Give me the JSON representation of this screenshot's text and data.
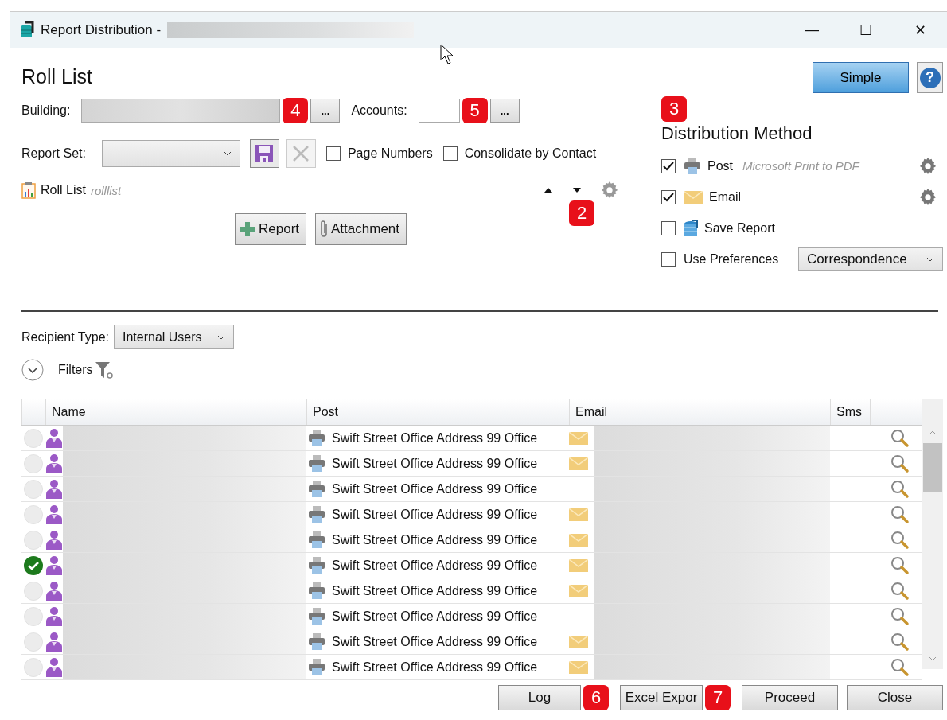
{
  "window": {
    "title": "Report Distribution -",
    "controls": [
      "—",
      "☐",
      "✕"
    ]
  },
  "heading": "Roll List",
  "simple_button": "Simple",
  "help_button": "?",
  "building": {
    "label": "Building:",
    "browse": "...",
    "callout": "4"
  },
  "accounts": {
    "label": "Accounts:",
    "browse": "...",
    "callout": "5"
  },
  "report_set": {
    "label": "Report Set:"
  },
  "options": [
    {
      "label": "Page Numbers",
      "checked": false
    },
    {
      "label": "Consolidate by Contact",
      "checked": false
    }
  ],
  "report_item": {
    "name": "Roll List",
    "code": "rolllist",
    "callout": "2"
  },
  "add_buttons": [
    {
      "kind": "report",
      "label": "Report"
    },
    {
      "kind": "attachment",
      "label": "Attachment"
    }
  ],
  "distribution": {
    "title": "Distribution Method",
    "callout": "3",
    "methods": [
      {
        "kind": "post",
        "label": "Post",
        "detail": "Microsoft Print to PDF",
        "checked": true,
        "settings": true
      },
      {
        "kind": "email",
        "label": "Email",
        "checked": true,
        "settings": true
      },
      {
        "kind": "save",
        "label": "Save Report",
        "checked": false,
        "settings": false
      },
      {
        "kind": "preferences",
        "label": "Use Preferences",
        "checked": false,
        "settings": false,
        "value": "Correspondence"
      }
    ]
  },
  "recipient_type": {
    "label": "Recipient Type:",
    "value": "Internal Users"
  },
  "filters": {
    "label": "Filters",
    "expanded": false
  },
  "table": {
    "columns": [
      "Name",
      "Post",
      "Email",
      "Sms"
    ],
    "rows": [
      {
        "sent": false,
        "post": "Swift Street Office Address 99 Office",
        "email": true
      },
      {
        "sent": false,
        "post": "Swift Street Office Address 99 Office",
        "email": true
      },
      {
        "sent": false,
        "post": "Swift Street Office Address 99 Office",
        "email": false
      },
      {
        "sent": false,
        "post": "Swift Street Office Address 99 Office",
        "email": true
      },
      {
        "sent": false,
        "post": "Swift Street Office Address 99 Office",
        "email": true
      },
      {
        "sent": true,
        "post": "Swift Street Office Address 99 Office",
        "email": true
      },
      {
        "sent": false,
        "post": "Swift Street Office Address 99 Office",
        "email": true
      },
      {
        "sent": false,
        "post": "Swift Street Office Address 99 Office",
        "email": false
      },
      {
        "sent": false,
        "post": "Swift Street Office Address 99 Office",
        "email": true
      },
      {
        "sent": false,
        "post": "Swift Street Office Address 99 Office",
        "email": true
      }
    ]
  },
  "buttons": [
    {
      "label": "Log",
      "callout": "6"
    },
    {
      "label": "Excel Expor",
      "callout": "7"
    },
    {
      "label": "Proceed"
    },
    {
      "label": "Close"
    }
  ]
}
